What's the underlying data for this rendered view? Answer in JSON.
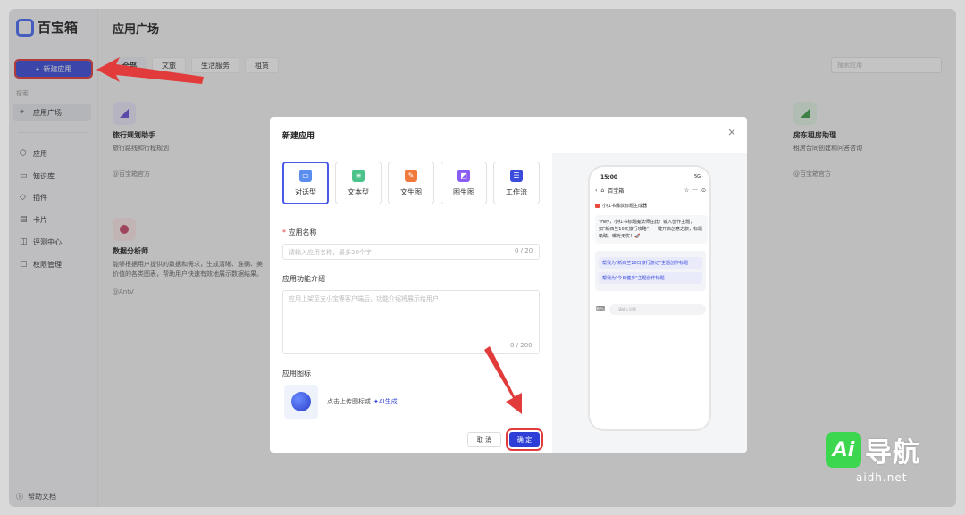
{
  "brand": {
    "name": "百宝箱",
    "sub": ""
  },
  "sidebar": {
    "new_app_label": "新建应用",
    "section_label": "探索",
    "items": [
      {
        "label": "应用广场",
        "icon": "compass-icon"
      },
      {
        "label": "应用",
        "icon": "cube-icon"
      },
      {
        "label": "知识库",
        "icon": "folder-icon"
      },
      {
        "label": "插件",
        "icon": "puzzle-icon"
      },
      {
        "label": "卡片",
        "icon": "card-icon"
      },
      {
        "label": "评测中心",
        "icon": "chart-icon"
      },
      {
        "label": "权限管理",
        "icon": "lock-icon"
      }
    ],
    "help_label": "帮助文档"
  },
  "main": {
    "title": "应用广场",
    "tabs": [
      "全部",
      "文旅",
      "生活服务",
      "租赁"
    ],
    "search_placeholder": "搜索应用",
    "cards": [
      {
        "title": "旅行规划助手",
        "desc": "旅行路线和行程规划",
        "author": "@百宝箱官方"
      },
      {
        "title": "房东租房助理",
        "desc": "租房合同创建和问答咨询",
        "author": "@百宝箱官方"
      },
      {
        "title": "数据分析师",
        "desc": "能够根据用户提供的数据和需求，生成清晰、准确、美",
        "desc2": "价值的各类图表，帮助用户快速有效地展示数据结果。",
        "author": "@AntV"
      }
    ]
  },
  "modal": {
    "title": "新建应用",
    "types": [
      {
        "label": "对话型",
        "color": "#5b8def",
        "icon": "chat-icon"
      },
      {
        "label": "文本型",
        "color": "#4cc38a",
        "icon": "text-icon"
      },
      {
        "label": "文生图",
        "color": "#f07a3c",
        "icon": "image-gen-icon"
      },
      {
        "label": "图生图",
        "color": "#8a5cf6",
        "icon": "image-icon"
      },
      {
        "label": "工作流",
        "color": "#3b4bdb",
        "icon": "workflow-icon"
      }
    ],
    "name_label": "应用名称",
    "name_placeholder": "请输入应用名称，最多20个字",
    "name_counter": "0 / 20",
    "intro_label": "应用功能介绍",
    "intro_placeholder": "应用上架至支小宝等客户端后，功能介绍将展示给用户",
    "intro_counter": "0 / 200",
    "icon_label": "应用图标",
    "upload_hint": "点击上传图标或",
    "ai_gen": "✦AI生成",
    "cancel_label": "取 消",
    "ok_label": "确 定"
  },
  "preview": {
    "time": "15:00",
    "status_right": "5G",
    "nav_title": "百宝箱",
    "app_title": "小红书爆款标题生成器",
    "message": "\"Hey，小红书标题魔法师在此！输入创作主题，如\"新西兰10天旅行攻略\"，一键开启创意之旅，标题吸睛，曝光无忧！🚀",
    "sugg_label": "",
    "suggestions": [
      "帮我为\"新西兰10日旅行游记\"主题创作标题",
      "帮我为\"今日健身\"主题创作标题"
    ],
    "input_placeholder": "请输入问题"
  },
  "watermark": {
    "ai": "Ai",
    "text": "导航",
    "url": "aidh.net"
  },
  "colors": {
    "accent": "#3b4bdb",
    "annotation": "#e23b3b"
  }
}
